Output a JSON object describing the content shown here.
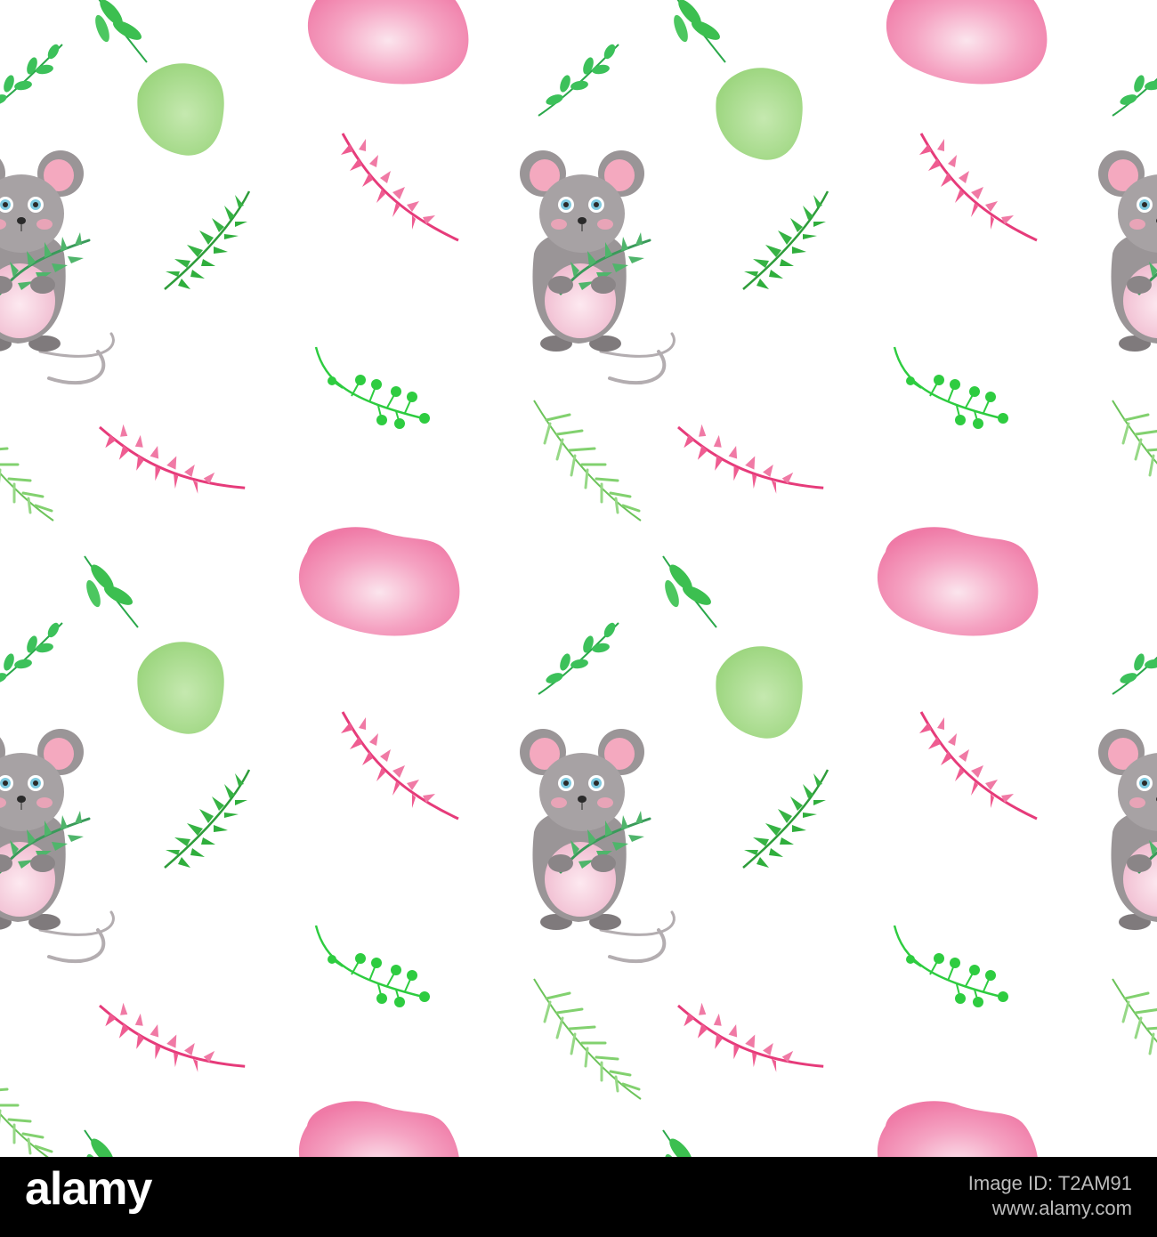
{
  "image": {
    "subject": "seamless-watercolor-mouse-pattern",
    "background_color": "#ffffff",
    "colors": {
      "mouse_gray": "#9a9597",
      "mouse_belly": "#f3c7d6",
      "mouse_ear": "#f4a9bf",
      "mouse_eye": "#7fc9df",
      "pink_blob": "#f27aa6",
      "green_blob": "#9fd97a",
      "leaf_green": "#2ecc40",
      "leaf_light_green": "#7ed36a",
      "pink_sprig": "#e63b7a"
    }
  },
  "watermark": {
    "brand": "alamy",
    "label": "Image ID: T2AM91",
    "site": "www.alamy.com"
  }
}
